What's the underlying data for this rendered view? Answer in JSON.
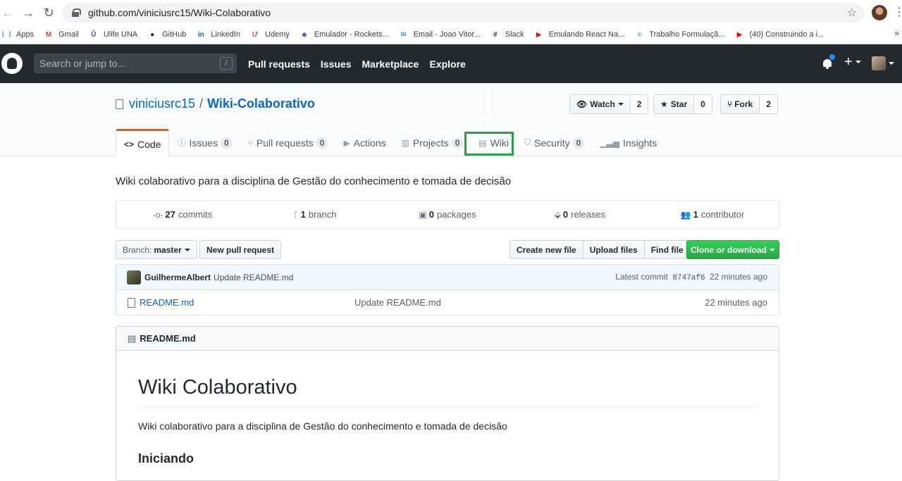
{
  "browser": {
    "url": "github.com/viniciusrc15/Wiki-Colaborativo",
    "bookmarks": [
      {
        "label": "Apps",
        "color": "#4285f4",
        "glyph": "⋮⋮"
      },
      {
        "label": "Gmail",
        "color": "#ea4335",
        "glyph": "M"
      },
      {
        "label": "Ulife UNA",
        "color": "#7b3fe4",
        "glyph": "Ů"
      },
      {
        "label": "GitHub",
        "color": "#24292e",
        "glyph": "●"
      },
      {
        "label": "LinkedIn",
        "color": "#0a66c2",
        "glyph": "in"
      },
      {
        "label": "Udemy",
        "color": "#ec5252",
        "glyph": "Ư"
      },
      {
        "label": "Emulador - Rockets...",
        "color": "#7159c1",
        "glyph": "◆"
      },
      {
        "label": "Email - Joao Vitor...",
        "color": "#0078d4",
        "glyph": "✉"
      },
      {
        "label": "Slack",
        "color": "#4a154b",
        "glyph": "#"
      },
      {
        "label": "Emulando React Na...",
        "color": "#ff0000",
        "glyph": "▶"
      },
      {
        "label": "Trabalho Formulaçã...",
        "color": "#4285f4",
        "glyph": "≡"
      },
      {
        "label": "(40) Construindo a i...",
        "color": "#ff0000",
        "glyph": "▶"
      }
    ],
    "more": "»"
  },
  "gh_header": {
    "search_placeholder": "Search or jump to...",
    "slash": "/",
    "nav": [
      "Pull requests",
      "Issues",
      "Marketplace",
      "Explore"
    ],
    "plus": "+"
  },
  "repo": {
    "owner": "viniciusrc15",
    "separator": "/",
    "name": "Wiki-Colaborativo",
    "watch_label": "Watch",
    "watch_count": "2",
    "star_label": "Star",
    "star_count": "0",
    "fork_label": "Fork",
    "fork_count": "2"
  },
  "tabs": [
    {
      "icon": "<>",
      "label": "Code",
      "count": ""
    },
    {
      "icon": "ⓘ",
      "label": "Issues",
      "count": "0"
    },
    {
      "icon": "⑂",
      "label": "Pull requests",
      "count": "0"
    },
    {
      "icon": "▶",
      "label": "Actions",
      "count": ""
    },
    {
      "icon": "▥",
      "label": "Projects",
      "count": "0"
    },
    {
      "icon": "▤",
      "label": "Wiki",
      "count": ""
    },
    {
      "icon": "⛉",
      "label": "Security",
      "count": "0"
    },
    {
      "icon": "▁▃▅",
      "label": "Insights",
      "count": ""
    }
  ],
  "description": "Wiki colaborativo para a disciplina de Gestão do conhecimento e tomada de decisão",
  "numbers": [
    {
      "icon": "-o-",
      "value": "27",
      "label": "commits"
    },
    {
      "icon": "ᚴ",
      "value": "1",
      "label": "branch"
    },
    {
      "icon": "▣",
      "value": "0",
      "label": "packages"
    },
    {
      "icon": "⬙",
      "value": "0",
      "label": "releases"
    },
    {
      "icon": "👥",
      "value": "1",
      "label": "contributor"
    }
  ],
  "filebar": {
    "branch_prefix": "Branch:",
    "branch_name": "master",
    "new_pr": "New pull request",
    "create_file": "Create new file",
    "upload_files": "Upload files",
    "find_file": "Find file",
    "clone": "Clone or download"
  },
  "commit": {
    "author": "GuilhermeAlbert",
    "message": "Update README.md",
    "latest_label": "Latest commit",
    "sha": "8747af6",
    "age": "22 minutes ago"
  },
  "files": [
    {
      "name": "README.md",
      "message": "Update README.md",
      "age": "22 minutes ago"
    }
  ],
  "readme": {
    "title": "README.md",
    "h1": "Wiki Colaborativo",
    "paragraph": "Wiki colaborativo para a disciplina de Gestão do conhecimento e tomada de decisão",
    "h2": "Iniciando"
  }
}
